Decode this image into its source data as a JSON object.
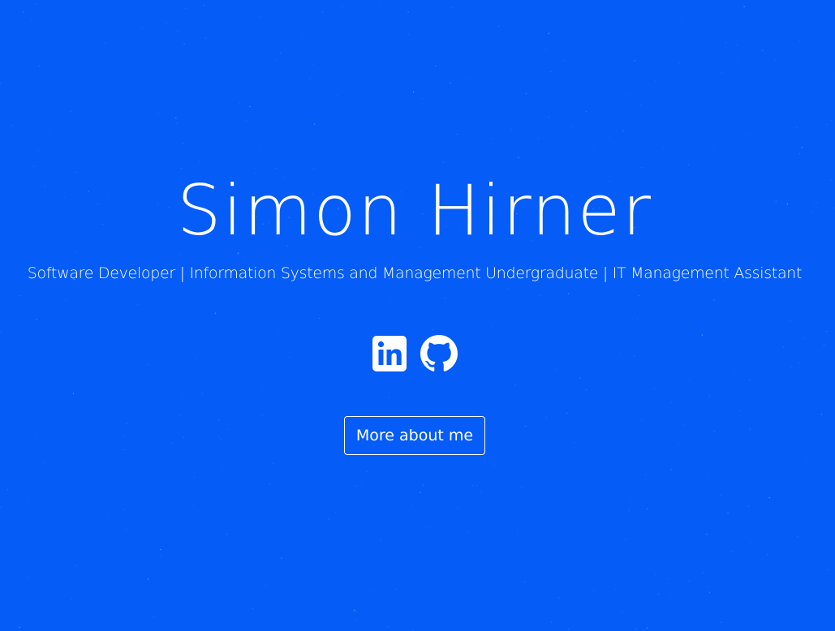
{
  "hero": {
    "name": "Simon Hirner",
    "tagline": "Software Developer | Information Systems and Management Undergraduate | IT Management Assistant",
    "cta_label": "More about me"
  },
  "social": [
    {
      "icon": "linkedin-icon"
    },
    {
      "icon": "github-icon"
    }
  ],
  "colors": {
    "background": "#055cf7",
    "foreground": "#ffffff"
  }
}
